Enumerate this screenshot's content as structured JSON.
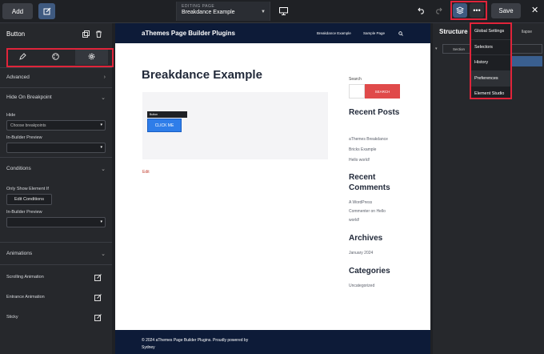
{
  "topbar": {
    "add_label": "Add",
    "editing_label": "EDITING PAGE",
    "editing_value": "Breakdance Example",
    "save_label": "Save"
  },
  "left_panel": {
    "title": "Button",
    "sections": {
      "advanced": "Advanced",
      "hide_on_breakpoint": "Hide On Breakpoint",
      "conditions": "Conditions",
      "animations": "Animations"
    },
    "hide_label": "Hide",
    "hide_placeholder": "Choose breakpoints",
    "in_builder_preview_1": "In-Builder Preview",
    "only_show_label": "Only Show Element If",
    "edit_conditions": "Edit Conditions",
    "in_builder_preview_2": "In-Builder Preview",
    "scrolling_animation": "Scrolling Animation",
    "entrance_animation": "Entrance Animation",
    "sticky": "Sticky"
  },
  "site": {
    "title": "aThemes Page Builder Plugins",
    "nav": [
      "Breakdance Example",
      "Sample Page"
    ],
    "heading": "Breakdance Example",
    "mini_toolbar": "Button",
    "click_button": "CLICK ME",
    "edit_link": "Edit",
    "sidebar": {
      "search_label": "Search",
      "search_button": "SEARCH",
      "recent_posts_title": "Recent Posts",
      "recent_posts": [
        "aThemes Breakdance",
        "Bricks Example",
        "Hello world!"
      ],
      "recent_comments_title": "Recent Comments",
      "recent_comments": [
        "A WordPress",
        "Commenter on Hello",
        "world!"
      ],
      "archives_title": "Archives",
      "archives": [
        "January 2024"
      ],
      "categories_title": "Categories",
      "categories": [
        "Uncategorized"
      ]
    },
    "footer_line1": "© 2024 aThemes Page Builder Plugins. Proudly powered by",
    "footer_line2": "Sydney"
  },
  "right_panel": {
    "title": "Structure",
    "collapse": "llapse",
    "tree_section": "Section",
    "tree_button": "Butt"
  },
  "menu": {
    "items": [
      "Global Settings",
      "Selectors",
      "History",
      "Preferences",
      "Element Studio"
    ]
  },
  "colors": {
    "highlight": "#e0243a",
    "accent": "#3f5a80",
    "site_nav": "#0d1b38",
    "cta_blue": "#2e7de9",
    "search_red": "#e04a4a"
  }
}
